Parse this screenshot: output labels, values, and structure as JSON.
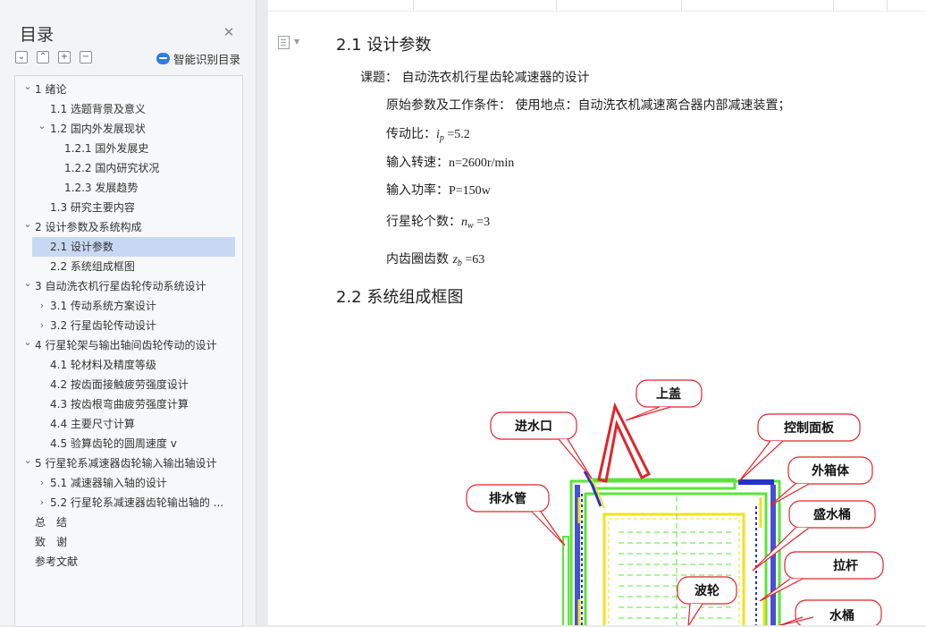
{
  "toc": {
    "title": "目录",
    "smart_label": "智能识别目录",
    "items": [
      {
        "level": 1,
        "chev": "v",
        "label": "1 绪论"
      },
      {
        "level": 2,
        "chev": "",
        "label": "1.1 选题背景及意义"
      },
      {
        "level": 2,
        "chev": "v",
        "label": "1.2 国内外发展现状"
      },
      {
        "level": 3,
        "chev": "",
        "label": "1.2.1 国外发展史"
      },
      {
        "level": 3,
        "chev": "",
        "label": "1.2.2 国内研究状况"
      },
      {
        "level": 3,
        "chev": "",
        "label": "1.2.3 发展趋势"
      },
      {
        "level": 2,
        "chev": "",
        "label": "1.3 研究主要内容"
      },
      {
        "level": 1,
        "chev": "v",
        "label": "2 设计参数及系统构成"
      },
      {
        "level": 2,
        "chev": "",
        "label": "2.1 设计参数",
        "active": true
      },
      {
        "level": 2,
        "chev": "",
        "label": "2.2 系统组成框图"
      },
      {
        "level": 1,
        "chev": "v",
        "label": "3 自动洗衣机行星齿轮传动系统设计"
      },
      {
        "level": 2,
        "chev": ">",
        "label": "3.1 传动系统方案设计"
      },
      {
        "level": 2,
        "chev": ">",
        "label": "3.2 行星齿轮传动设计"
      },
      {
        "level": 1,
        "chev": "v",
        "label": "4 行星轮架与输出轴间齿轮传动的设计"
      },
      {
        "level": 2,
        "chev": "",
        "label": "4.1 轮材料及精度等级"
      },
      {
        "level": 2,
        "chev": "",
        "label": "4.2 按齿面接触疲劳强度设计"
      },
      {
        "level": 2,
        "chev": "",
        "label": "4.3 按齿根弯曲疲劳强度计算"
      },
      {
        "level": 2,
        "chev": "",
        "label": "4.4 主要尺寸计算"
      },
      {
        "level": 2,
        "chev": "",
        "label": "4.5 验算齿轮的圆周速度 v"
      },
      {
        "level": 1,
        "chev": "v",
        "label": "5 行星轮系减速器齿轮输入输出轴设计"
      },
      {
        "level": 2,
        "chev": ">",
        "label": "5.1 减速器输入轴的设计"
      },
      {
        "level": 2,
        "chev": ">",
        "label": "5.2 行星轮系减速器齿轮输出轴的 ..."
      },
      {
        "level": 0,
        "chev": "",
        "label": "总　结"
      },
      {
        "level": 0,
        "chev": "",
        "label": "致　谢"
      },
      {
        "level": 0,
        "chev": "",
        "label": "参考文献"
      }
    ]
  },
  "doc": {
    "h_21": "2.1 设计参数",
    "topic": "课题：  自动洗衣机行星齿轮减速器的设计",
    "conditions": "原始参数及工作条件：  使用地点：自动洗衣机减速离合器内部减速装置；",
    "ratio_label": "传动比：",
    "ratio_sym": "i",
    "ratio_sub": "p",
    "ratio_val": " =5.2",
    "speed_label": "输入转速：",
    "speed_val": "n=2600r/min",
    "power_label": "输入功率：",
    "power_val": "P=150w",
    "planet_label": "行星轮个数：",
    "planet_sym": "n",
    "planet_sub": "w",
    "planet_val": " =3",
    "ring_label": "内齿圈齿数 ",
    "ring_sym": "z",
    "ring_sub": "b",
    "ring_val": " =63",
    "h_22": "2.2 系统组成框图"
  },
  "diagram": {
    "labels": {
      "lid": "上盖",
      "inlet": "进水口",
      "panel": "控制面板",
      "outer_box": "外箱体",
      "drain": "排水管",
      "tub": "盛水桶",
      "rod": "拉杆",
      "pulsator": "波轮",
      "bucket": "水桶"
    },
    "colors": {
      "callout_stroke": "#e0252b",
      "green": "#5be53a",
      "yellow": "#f1e21a",
      "blue": "#2432c8",
      "red": "#e0252b"
    }
  }
}
